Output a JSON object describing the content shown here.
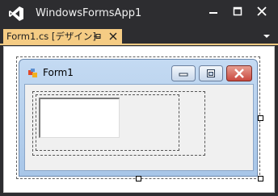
{
  "app": {
    "title": "WindowsFormsApp1",
    "logo_icon": "visual-studio-logo",
    "controls": [
      "minimize-icon",
      "maximize-icon",
      "close-icon"
    ]
  },
  "document_tab": {
    "label": "Form1.cs [デザイン]",
    "icons": [
      "pin-icon",
      "close-icon"
    ],
    "active_color": "#f5cc84"
  },
  "form": {
    "title": "Form1",
    "icon": "form-icon",
    "caption_buttons": [
      "minimize-button",
      "maximize-button",
      "close-button"
    ],
    "close_color": "#c9463d"
  },
  "controls": [
    {
      "type": "groupbox"
    },
    {
      "type": "panel"
    },
    {
      "type": "textbox"
    }
  ]
}
